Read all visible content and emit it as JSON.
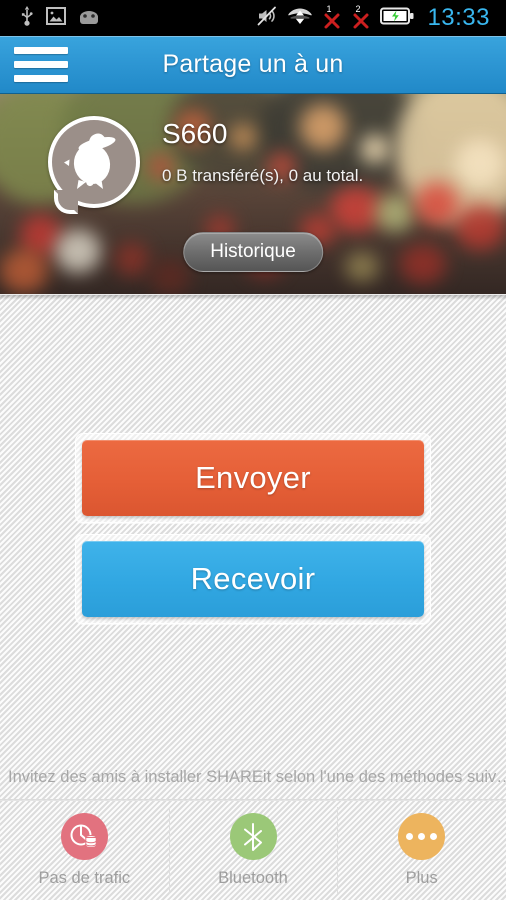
{
  "statusbar": {
    "icons_left": [
      "usb-icon",
      "screenshot-image-icon",
      "android-head-icon"
    ],
    "icons_right": [
      "mute-icon",
      "data-transfer-icon",
      "sim1-no-signal-icon",
      "sim2-no-signal-icon",
      "battery-charging-icon"
    ],
    "sim1_label": "1",
    "sim2_label": "2",
    "clock": "13:33",
    "clock_color": "#39b7ef",
    "background": "#000000"
  },
  "titlebar": {
    "menu_icon": "hamburger-menu-icon",
    "title": "Partage un à un",
    "background": "#2e97d4"
  },
  "profile": {
    "avatar_icon": "shareit-bird-avatar",
    "device_name": "S660",
    "transfer_status": "0 B transféré(s), 0 au total.",
    "history_label": "Historique"
  },
  "main": {
    "send_label": "Envoyer",
    "send_color": "#e55f37",
    "receive_label": "Recevoir",
    "receive_color": "#31a7e2"
  },
  "invite": {
    "hint": "Invitez des amis à installer SHAREit selon l'une des méthodes suiv…"
  },
  "bottombar": {
    "items": [
      {
        "icon": "no-traffic-data-icon",
        "label": "Pas de trafic",
        "color": "#e2727f"
      },
      {
        "icon": "bluetooth-icon",
        "label": "Bluetooth",
        "color": "#9bc878"
      },
      {
        "icon": "more-dots-icon",
        "label": "Plus",
        "color": "#edb45e"
      }
    ]
  }
}
